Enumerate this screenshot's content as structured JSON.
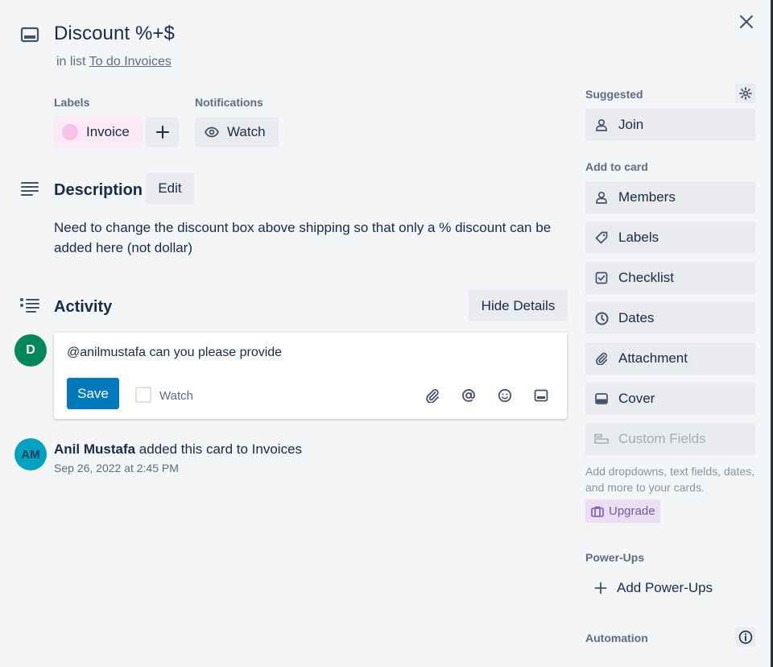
{
  "card": {
    "title": "Discount %+$",
    "in_list_prefix": "in list",
    "list_name": "To do Invoices"
  },
  "labels": {
    "heading": "Labels",
    "items": [
      {
        "name": "Invoice",
        "color": "#f8c2e6"
      }
    ],
    "add_symbol": "+"
  },
  "notifications": {
    "heading": "Notifications",
    "watch_label": "Watch"
  },
  "description": {
    "heading": "Description",
    "edit_label": "Edit",
    "text": "Need to change the discount box above shipping so that only a % discount can be added here (not dollar)"
  },
  "activity": {
    "heading": "Activity",
    "hide_details_label": "Hide Details",
    "composer": {
      "avatar_initial": "D",
      "avatar_color": "#00875a",
      "text": "@anilmustafa can you please provide",
      "save_label": "Save",
      "watch_label": "Watch",
      "icons": [
        "paperclip-icon",
        "at-icon",
        "emoji-icon",
        "card-icon"
      ]
    },
    "entries": [
      {
        "avatar_initials": "AM",
        "avatar_color": "#00a3bf",
        "author": "Anil Mustafa",
        "action": "added this card to Invoices",
        "timestamp": "Sep 26, 2022 at 2:45 PM"
      }
    ]
  },
  "sidebar": {
    "suggested_heading": "Suggested",
    "join_label": "Join",
    "add_to_card_heading": "Add to card",
    "add_to_card": [
      {
        "label": "Members",
        "icon": "person-icon"
      },
      {
        "label": "Labels",
        "icon": "tag-icon"
      },
      {
        "label": "Checklist",
        "icon": "checkbox-icon"
      },
      {
        "label": "Dates",
        "icon": "clock-icon"
      },
      {
        "label": "Attachment",
        "icon": "paperclip-icon"
      },
      {
        "label": "Cover",
        "icon": "cover-icon"
      },
      {
        "label": "Custom Fields",
        "icon": "custom-fields-icon"
      }
    ],
    "custom_fields_note": "Add dropdowns, text fields, dates, and more to your cards.",
    "upgrade_label": "Upgrade",
    "powerups_heading": "Power-Ups",
    "add_powerups_label": "Add Power-Ups",
    "automation_heading": "Automation"
  },
  "colors": {
    "accent": "#0079bf",
    "background": "#f4f5f7",
    "button_bg": "#e9ebee"
  }
}
